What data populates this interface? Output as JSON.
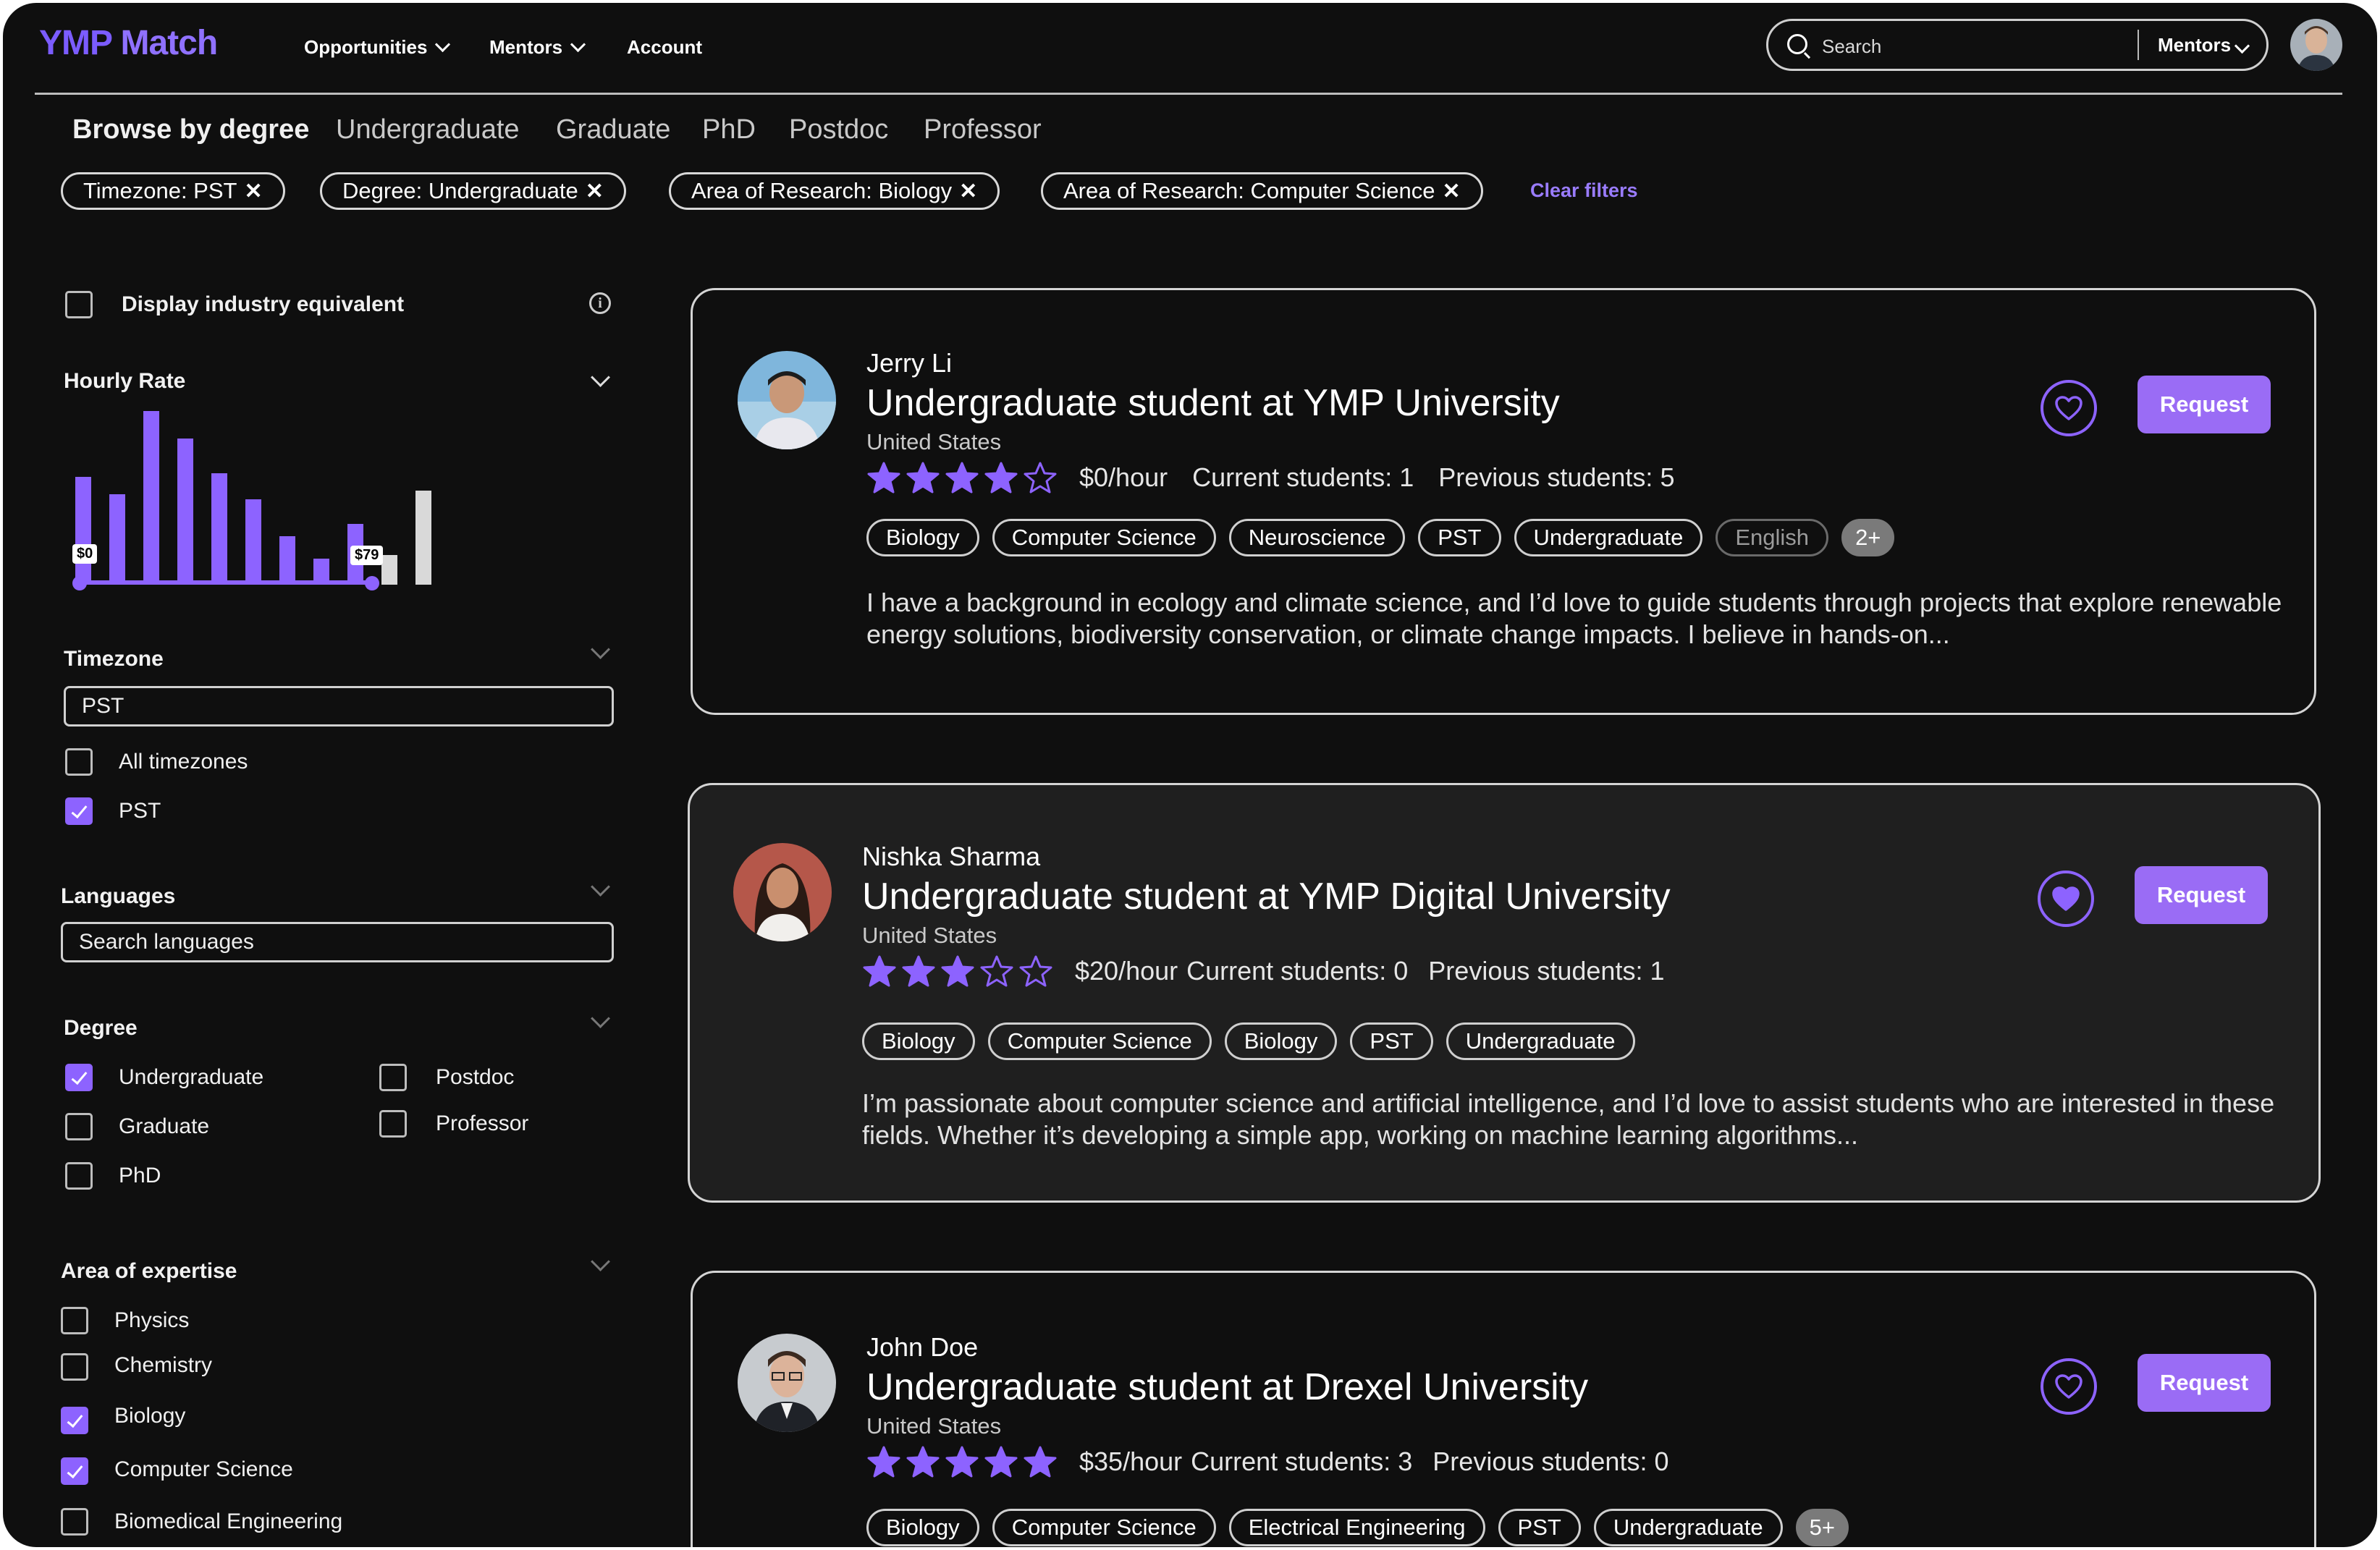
{
  "header": {
    "logo_ymp": "YMP",
    "logo_match": " Match",
    "nav": [
      "Opportunities",
      "Mentors",
      "Account"
    ],
    "search_placeholder": "Search",
    "search_scope": "Mentors"
  },
  "degree_tabs": {
    "heading": "Browse by degree",
    "items": [
      "Undergraduate",
      "Graduate",
      "PhD",
      "Postdoc",
      "Professor"
    ]
  },
  "active_filters": [
    "Timezone: PST",
    "Degree: Undergraduate",
    "Area of Research: Biology",
    "Area of Research: Computer Science"
  ],
  "clear_filters": "Clear filters",
  "sidebar": {
    "industry_equivalent": {
      "label": "Display industry equivalent",
      "checked": false
    },
    "hourly_rate": {
      "label": "Hourly Rate",
      "min_label": "$0",
      "max_label": "$79",
      "histogram_heights": [
        0.62,
        0.52,
        1.0,
        0.84,
        0.64,
        0.49,
        0.28,
        0.15,
        0.35,
        0.17,
        0.54
      ]
    },
    "timezone": {
      "label": "Timezone",
      "value": "PST",
      "options": [
        {
          "label": "All timezones",
          "checked": false
        },
        {
          "label": "PST",
          "checked": true
        }
      ]
    },
    "languages": {
      "label": "Languages",
      "placeholder": "Search languages"
    },
    "degree": {
      "label": "Degree",
      "options": [
        {
          "label": "Undergraduate",
          "checked": true
        },
        {
          "label": "Graduate",
          "checked": false
        },
        {
          "label": "PhD",
          "checked": false
        },
        {
          "label": "Postdoc",
          "checked": false
        },
        {
          "label": "Professor",
          "checked": false
        }
      ]
    },
    "expertise": {
      "label": "Area of expertise",
      "options": [
        {
          "label": "Physics",
          "checked": false
        },
        {
          "label": "Chemistry",
          "checked": false
        },
        {
          "label": "Biology",
          "checked": true
        },
        {
          "label": "Computer Science",
          "checked": true
        },
        {
          "label": "Biomedical Engineering",
          "checked": false
        }
      ]
    }
  },
  "mentors": [
    {
      "name": "Jerry Li",
      "title": "Undergraduate student at YMP University",
      "location": "United States",
      "rating": 4,
      "rate": "$0/hour",
      "current": "Current students: 1",
      "previous": "Previous students: 5",
      "tags": [
        "Biology",
        "Computer Science",
        "Neuroscience",
        "PST",
        "Undergraduate"
      ],
      "dim_tag": "English",
      "more": "2+",
      "favorited": false,
      "description": "I have a background in ecology and climate science, and I’d love to guide students through projects that explore renewable energy solutions, biodiversity conservation, or climate change impacts. I believe in hands-on...",
      "button": "Request"
    },
    {
      "name": "Nishka Sharma",
      "title": "Undergraduate student at YMP Digital University",
      "location": "United States",
      "rating": 3,
      "rate": "$20/hour",
      "current": "Current students: 0",
      "previous": "Previous students: 1",
      "tags": [
        "Biology",
        "Computer Science",
        "Biology",
        "PST",
        "Undergraduate"
      ],
      "dim_tag": "",
      "more": "",
      "favorited": true,
      "description": "I’m passionate about computer science and artificial intelligence, and I’d love to assist students who are interested in these fields. Whether it’s developing a simple app, working on machine learning algorithms...",
      "button": "Request"
    },
    {
      "name": "John Doe",
      "title": "Undergraduate student at Drexel University",
      "location": "United States",
      "rating": 5,
      "rate": "$35/hour",
      "current": "Current students: 3",
      "previous": "Previous students: 0",
      "tags": [
        "Biology",
        "Computer Science",
        "Electrical Engineering",
        "PST",
        "Undergraduate"
      ],
      "dim_tag": "",
      "more": "5+",
      "favorited": false,
      "description": "",
      "button": "Request"
    }
  ],
  "colors": {
    "accent": "#8d63ff",
    "button": "#9a6cf5",
    "background": "#0f0f0f",
    "active_card": "#1f1f1f",
    "logo": "#7b5cff"
  }
}
